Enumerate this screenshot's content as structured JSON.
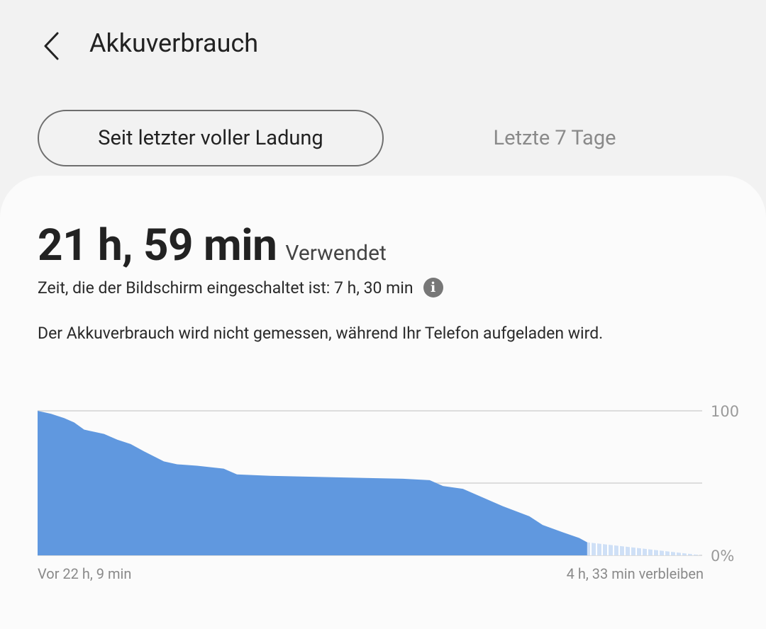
{
  "header": {
    "title": "Akkuverbrauch",
    "back_icon": "chevron-left-icon"
  },
  "tabs": [
    {
      "label": "Seit letzter voller Ladung",
      "active": true
    },
    {
      "label": "Letzte 7 Tage",
      "active": false
    }
  ],
  "summary": {
    "used_value": "21 h, 59 min",
    "used_label": "Verwendet",
    "screen_on": "Zeit, die der Bildschirm eingeschaltet ist: 7 h, 30 min",
    "info_icon": "info-icon",
    "notice": "Der Akkuverbrauch wird nicht gemessen, während Ihr Telefon aufgeladen wird."
  },
  "chart_data": {
    "type": "area",
    "x_start_label": "Vor 22 h, 9 min",
    "x_end_label": "4 h, 33 min verbleiben",
    "y_tick_labels": [
      "100",
      "0%"
    ],
    "ylim": [
      0,
      100
    ],
    "grid": true,
    "colors": {
      "used": "#6098df",
      "projected": "#cfe0f6",
      "grid": "#dddddd"
    },
    "series": [
      {
        "points": [
          [
            0.0,
            100
          ],
          [
            0.02,
            98
          ],
          [
            0.04,
            95
          ],
          [
            0.055,
            92
          ],
          [
            0.07,
            87
          ],
          [
            0.1,
            84
          ],
          [
            0.12,
            80
          ],
          [
            0.14,
            77
          ],
          [
            0.16,
            72
          ],
          [
            0.19,
            65
          ],
          [
            0.21,
            63
          ],
          [
            0.24,
            62
          ],
          [
            0.28,
            60
          ],
          [
            0.3,
            56
          ],
          [
            0.35,
            55
          ],
          [
            0.45,
            54
          ],
          [
            0.55,
            53
          ],
          [
            0.59,
            52
          ],
          [
            0.61,
            48
          ],
          [
            0.64,
            46
          ],
          [
            0.67,
            40
          ],
          [
            0.7,
            34
          ],
          [
            0.74,
            27
          ],
          [
            0.76,
            21
          ],
          [
            0.79,
            16
          ],
          [
            0.815,
            12
          ],
          [
            0.827,
            9
          ]
        ],
        "projection": [
          [
            0.827,
            9
          ],
          [
            1.0,
            0
          ]
        ]
      }
    ]
  }
}
